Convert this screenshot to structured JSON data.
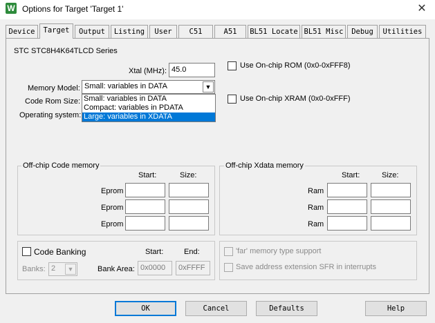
{
  "window": {
    "title": "Options for Target 'Target 1'",
    "icon": "keil-uvision-icon",
    "close_glyph": "✕"
  },
  "tabs": [
    {
      "label": "Device"
    },
    {
      "label": "Target",
      "active": true
    },
    {
      "label": "Output"
    },
    {
      "label": "Listing"
    },
    {
      "label": "User"
    },
    {
      "label": "C51"
    },
    {
      "label": "A51"
    },
    {
      "label": "BL51 Locate"
    },
    {
      "label": "BL51 Misc"
    },
    {
      "label": "Debug"
    },
    {
      "label": "Utilities"
    }
  ],
  "target": {
    "device_name": "STC STC8H4K64TLCD Series",
    "xtal_label": "Xtal (MHz):",
    "xtal_value": "45.0",
    "use_onchip_rom_label": "Use On-chip ROM (0x0-0xFFF8)",
    "use_onchip_xram_label": "Use On-chip XRAM (0x0-0xFFF)",
    "memory_model_label": "Memory Model:",
    "memory_model_value": "Small: variables in DATA",
    "memory_model_options": [
      "Small: variables in DATA",
      "Compact: variables in PDATA",
      "Large: variables in XDATA"
    ],
    "memory_model_highlighted": "Large: variables in XDATA",
    "code_rom_size_label": "Code Rom Size:",
    "operating_system_label": "Operating system:"
  },
  "offchip_code": {
    "title": "Off-chip Code memory",
    "start_header": "Start:",
    "size_header": "Size:",
    "rows": [
      {
        "label": "Eprom",
        "start": "",
        "size": ""
      },
      {
        "label": "Eprom",
        "start": "",
        "size": ""
      },
      {
        "label": "Eprom",
        "start": "",
        "size": ""
      }
    ]
  },
  "offchip_xdata": {
    "title": "Off-chip Xdata memory",
    "start_header": "Start:",
    "size_header": "Size:",
    "rows": [
      {
        "label": "Ram",
        "start": "",
        "size": ""
      },
      {
        "label": "Ram",
        "start": "",
        "size": ""
      },
      {
        "label": "Ram",
        "start": "",
        "size": ""
      }
    ]
  },
  "banking": {
    "code_banking_label": "Code Banking",
    "start_header": "Start:",
    "end_header": "End:",
    "banks_label": "Banks:",
    "banks_value": "2",
    "bank_area_label": "Bank Area:",
    "bank_start": "0x0000",
    "bank_end": "0xFFFF"
  },
  "misc": {
    "far_memory_label": "'far' memory type support",
    "save_sfr_label": "Save address extension SFR in interrupts"
  },
  "buttons": {
    "ok": "OK",
    "cancel": "Cancel",
    "defaults": "Defaults",
    "help": "Help"
  },
  "colors": {
    "selection": "#0078d7",
    "dialog_bg": "#f0f0f0"
  }
}
